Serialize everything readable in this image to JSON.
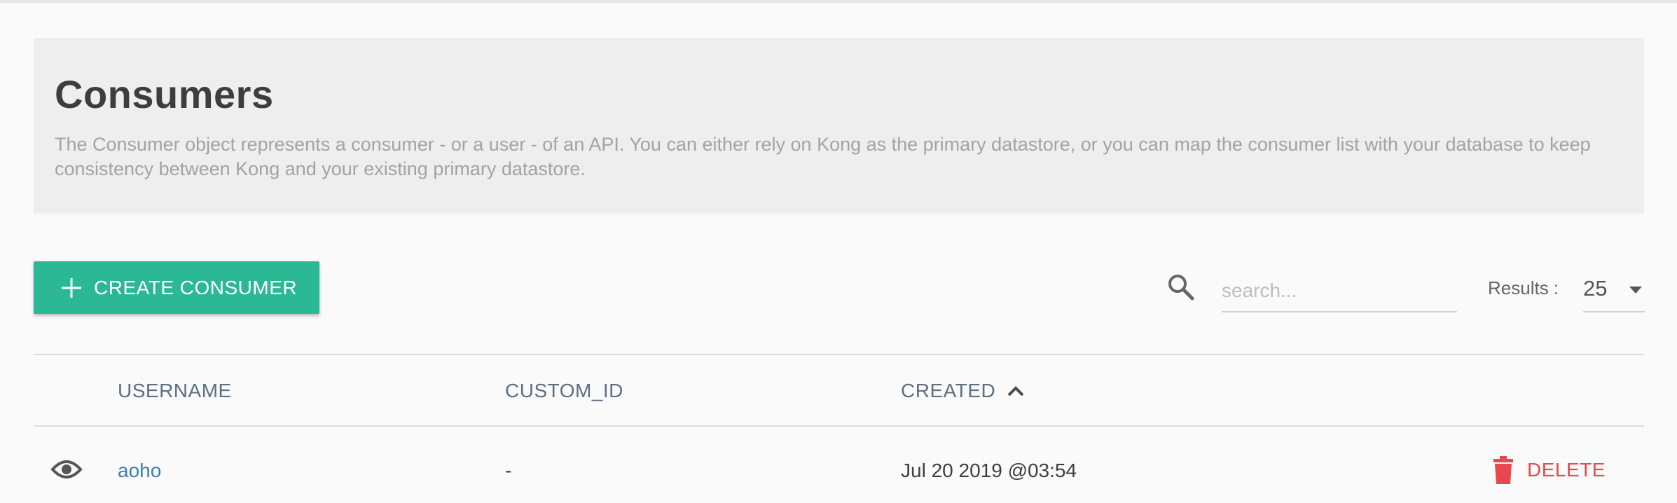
{
  "header": {
    "title": "Consumers",
    "description": "The Consumer object represents a consumer - or a user - of an API. You can either rely on Kong as the primary datastore, or you can map the consumer list with your database to keep consistency between Kong and your existing primary datastore."
  },
  "toolbar": {
    "create_label": "CREATE CONSUMER",
    "search_placeholder": "search...",
    "results_label": "Results :",
    "results_value": "25"
  },
  "table": {
    "columns": [
      "USERNAME",
      "CUSTOM_ID",
      "CREATED"
    ],
    "sort_column": "CREATED",
    "sort_direction": "ascending",
    "rows": [
      {
        "username": "aoho",
        "custom_id": "-",
        "created": "Jul 20 2019 @03:54",
        "action": "DELETE"
      }
    ]
  },
  "colors": {
    "accent": "#2bb995",
    "danger": "#e8474f",
    "link": "#3a7fad",
    "header_text": "#5d6f82"
  },
  "icons": [
    "plus-icon",
    "search-icon",
    "chevron-down-icon",
    "sort-up-icon",
    "eye-icon",
    "trash-icon"
  ]
}
